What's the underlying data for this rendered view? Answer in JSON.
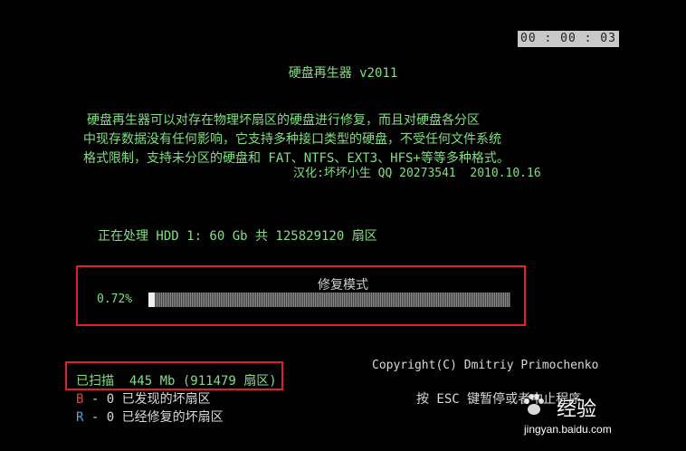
{
  "timer": "00 : 00 : 03",
  "title": "硬盘再生器 v2011",
  "description": {
    "line1": "硬盘再生器可以对存在物理坏扇区的硬盘进行修复，而且对硬盘各分区",
    "line2": "中现存数据没有任何影响，它支持多种接口类型的硬盘，不受任何文件系统",
    "line3": "格式限制，支持未分区的硬盘和 FAT、NTFS、EXT3、HFS+等等多种格式。"
  },
  "credit": "汉化:坏坏小生 QQ 20273541  2010.10.16",
  "processing": "正在处理 HDD 1: 60 Gb 共 125829120 扇区",
  "mode_label": "修复模式",
  "progress": {
    "label": "0.72%",
    "fraction": 0.0072
  },
  "scanned": "已扫描  445 Mb (911479 扇区)",
  "legend": {
    "found_key": "B",
    "found_text": " - 0 已发现的坏扇区",
    "fixed_key": "R",
    "fixed_text": " - 0 已经修复的坏扇区"
  },
  "copyright": "Copyright(C) Dmitriy Primochenko",
  "esc_hint": "按 ESC 键暂停或者中止程序",
  "watermark": {
    "brand": "经验",
    "url": "jingyan.baidu.com"
  },
  "colors": {
    "text": "#7fe07f",
    "highlight_box": "#e0202a",
    "key_b": "#e04848",
    "key_r": "#48a8e0"
  }
}
